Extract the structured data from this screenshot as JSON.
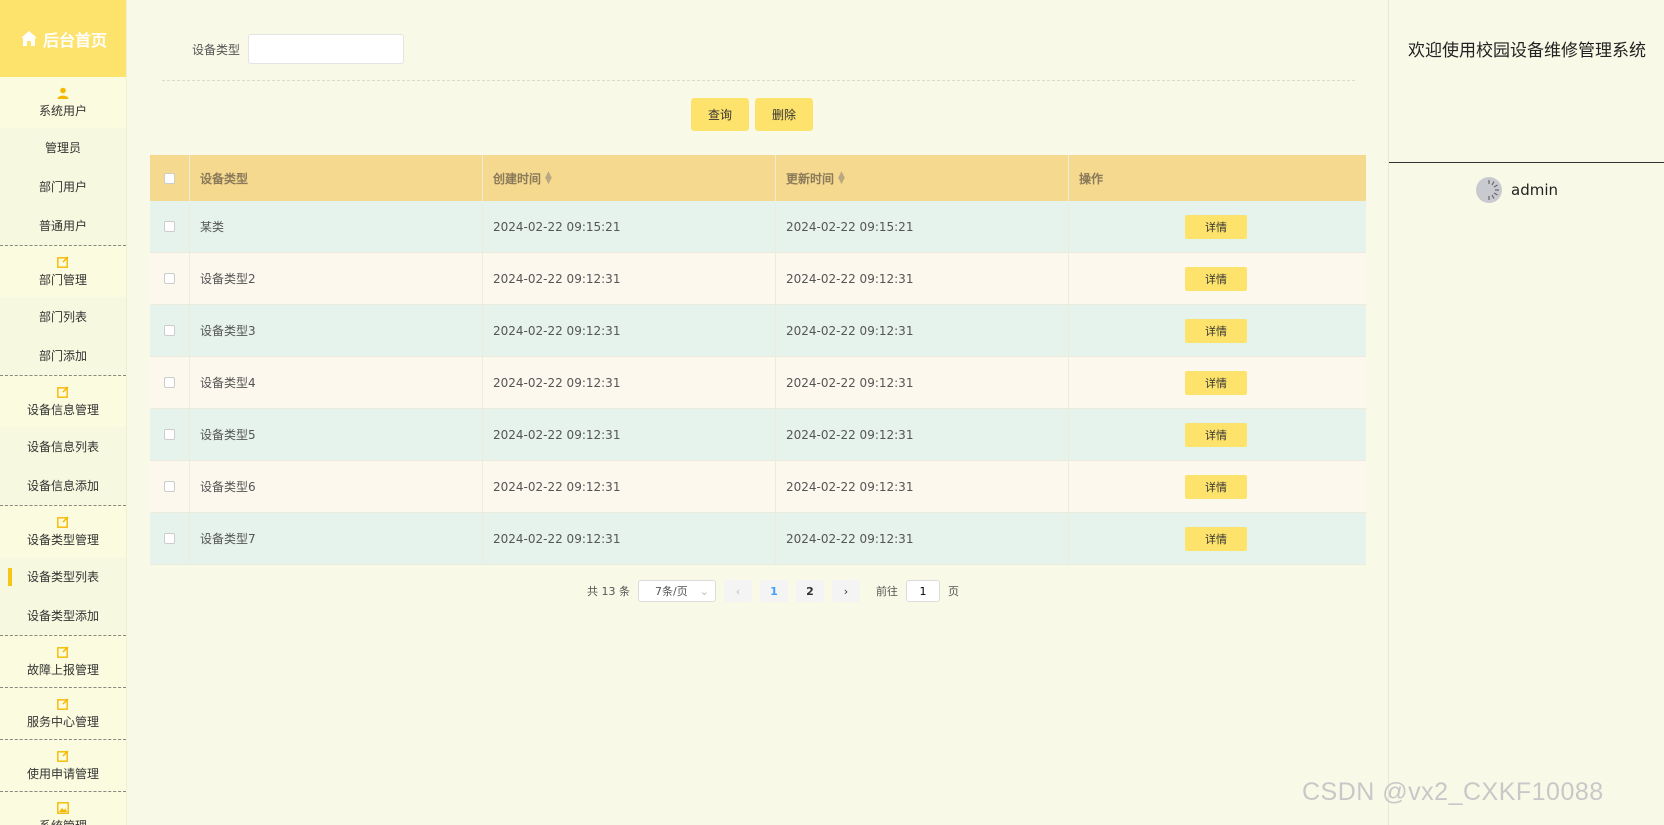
{
  "sidebar": {
    "home_label": "后台首页",
    "groups": [
      {
        "label": "系统用户",
        "icon": "user-icon",
        "items": [
          "管理员",
          "部门用户",
          "普通用户"
        ]
      },
      {
        "label": "部门管理",
        "icon": "edit-icon",
        "items": [
          "部门列表",
          "部门添加"
        ]
      },
      {
        "label": "设备信息管理",
        "icon": "edit-icon",
        "items": [
          "设备信息列表",
          "设备信息添加"
        ]
      },
      {
        "label": "设备类型管理",
        "icon": "edit-icon",
        "items": [
          "设备类型列表",
          "设备类型添加"
        ],
        "active_item": "设备类型列表"
      },
      {
        "label": "故障上报管理",
        "icon": "edit-icon",
        "items": []
      },
      {
        "label": "服务中心管理",
        "icon": "edit-icon",
        "items": []
      },
      {
        "label": "使用申请管理",
        "icon": "edit-icon",
        "items": []
      },
      {
        "label": "系统管理",
        "icon": "image-icon",
        "items": []
      }
    ]
  },
  "search": {
    "label": "设备类型",
    "value": "",
    "query_button": "查询",
    "delete_button": "删除"
  },
  "table": {
    "columns": [
      "设备类型",
      "创建时间",
      "更新时间",
      "操作"
    ],
    "rows": [
      {
        "type": "某类",
        "created": "2024-02-22 09:15:21",
        "updated": "2024-02-22 09:15:21"
      },
      {
        "type": "设备类型2",
        "created": "2024-02-22 09:12:31",
        "updated": "2024-02-22 09:12:31"
      },
      {
        "type": "设备类型3",
        "created": "2024-02-22 09:12:31",
        "updated": "2024-02-22 09:12:31"
      },
      {
        "type": "设备类型4",
        "created": "2024-02-22 09:12:31",
        "updated": "2024-02-22 09:12:31"
      },
      {
        "type": "设备类型5",
        "created": "2024-02-22 09:12:31",
        "updated": "2024-02-22 09:12:31"
      },
      {
        "type": "设备类型6",
        "created": "2024-02-22 09:12:31",
        "updated": "2024-02-22 09:12:31"
      },
      {
        "type": "设备类型7",
        "created": "2024-02-22 09:12:31",
        "updated": "2024-02-22 09:12:31"
      }
    ],
    "detail_label": "详情"
  },
  "pagination": {
    "total": "共 13 条",
    "page_size": "7条/页",
    "pages": [
      "1",
      "2"
    ],
    "current": "1",
    "goto_prefix": "前往",
    "goto_value": "1",
    "goto_suffix": "页"
  },
  "right_panel": {
    "welcome": "欢迎使用校园设备维修管理系统",
    "username": "admin"
  },
  "watermark": "CSDN @vx2_CXKF10088",
  "colors": {
    "accent": "#fde26c",
    "background": "#f9f9e8",
    "table_header": "#f5d98f",
    "row_odd": "#e6f3ec",
    "row_even": "#fcf8ee"
  }
}
